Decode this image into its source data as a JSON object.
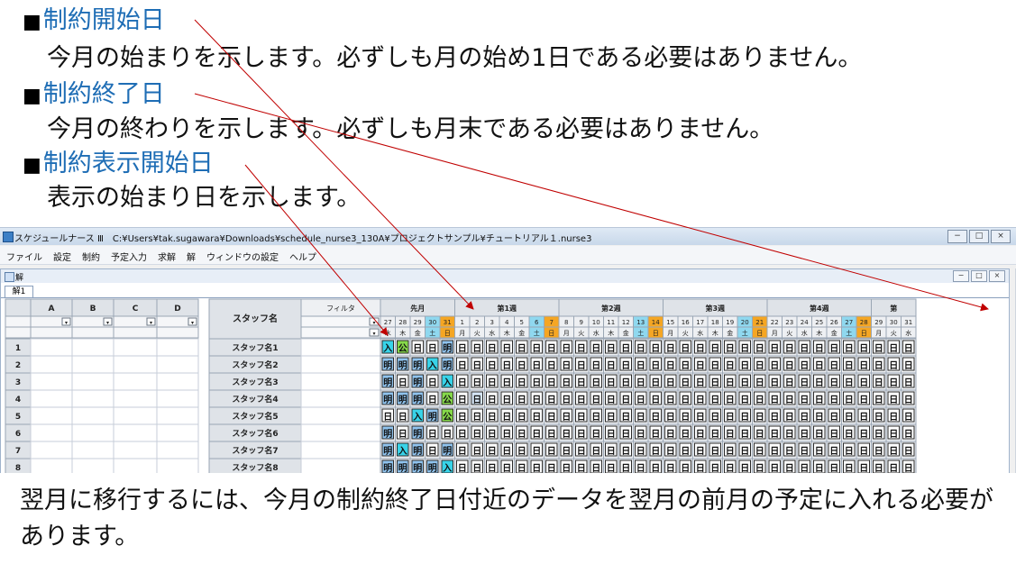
{
  "slide": {
    "bullet1_title": "制約開始日",
    "bullet1_desc": "今月の始まりを示します。必ずしも月の始め1日である必要はありません。",
    "bullet2_title": "制約終了日",
    "bullet2_desc": "今月の終わりを示します。必ずしも月末である必要はありません。",
    "bullet3_title": "制約表示開始日",
    "bullet3_desc": "表示の始まり日を示します。",
    "bullet_marker": "■",
    "bottom_text": "翌月に移行するには、今月の制約終了日付近のデータを翌月の前月の予定に入れる必要があります。"
  },
  "window": {
    "title": "スケジュールナース Ⅲ　C:¥Users¥tak.sugawara¥Downloads¥schedule_nurse3_130A¥プロジェクトサンプル¥チュートリアル１.nurse3",
    "minimize": "−",
    "maximize": "□",
    "close": "×"
  },
  "menu": [
    "ファイル",
    "設定",
    "制約",
    "予定入力",
    "求解",
    "解",
    "ウィンドウの設定",
    "ヘルプ"
  ],
  "document": {
    "title": "解",
    "tab": "解1"
  },
  "grid": {
    "left_columns": [
      "A",
      "B",
      "C",
      "D"
    ],
    "staff_header": "スタッフ名",
    "filter_label": "フィルタ",
    "week_labels": [
      "先月",
      "第1週",
      "第2週",
      "第3週",
      "第4週",
      "第"
    ],
    "days": [
      27,
      28,
      29,
      30,
      31,
      1,
      2,
      3,
      4,
      5,
      6,
      7,
      8,
      9,
      10,
      11,
      12,
      13,
      14,
      15,
      16,
      17,
      18,
      19,
      20,
      21,
      22,
      23,
      24,
      25,
      26,
      27,
      28,
      29,
      30,
      31
    ],
    "weekdays": [
      "水",
      "木",
      "金",
      "土",
      "日",
      "月",
      "火",
      "水",
      "木",
      "金",
      "土",
      "日",
      "月",
      "火",
      "水",
      "木",
      "金",
      "土",
      "日",
      "月",
      "火",
      "水",
      "木",
      "金",
      "土",
      "日",
      "月",
      "火",
      "水",
      "木",
      "金",
      "土",
      "日",
      "月",
      "火",
      "水"
    ],
    "row_numbers": [
      1,
      2,
      3,
      4,
      5,
      6,
      7,
      8
    ],
    "staff_names": [
      "スタッフ名1",
      "スタッフ名2",
      "スタッフ名3",
      "スタッフ名4",
      "スタッフ名5",
      "スタッフ名6",
      "スタッフ名7",
      "スタッフ名8"
    ],
    "prev_month_shifts": [
      [
        "入",
        "公",
        "日",
        "日",
        "明"
      ],
      [
        "明",
        "明",
        "明",
        "入",
        "明"
      ],
      [
        "明",
        "日",
        "明",
        "日",
        "入"
      ],
      [
        "明",
        "明",
        "明",
        "日",
        "公"
      ],
      [
        "日",
        "日",
        "入",
        "明",
        "公"
      ],
      [
        "明",
        "日",
        "明",
        "日",
        "日"
      ],
      [
        "明",
        "入",
        "明",
        "日",
        "明"
      ],
      [
        "明",
        "明",
        "明",
        "明",
        "入"
      ]
    ],
    "current_shift": "日",
    "highlighted_cell_row4": "日",
    "colors": {
      "sat_header": "#8fd8ef",
      "sun_header": "#f5a623",
      "shift_ake": "#8fc3ee",
      "shift_iri": "#38d3e8",
      "shift_ko": "#86d94a",
      "cell_border": "#2a2a2a",
      "arrow": "#c00000"
    }
  }
}
